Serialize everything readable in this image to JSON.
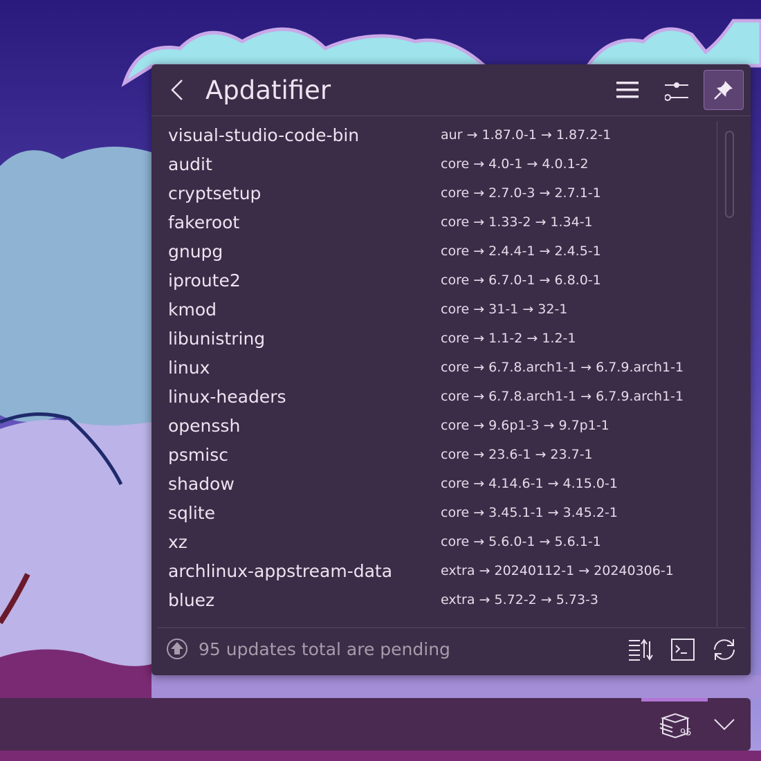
{
  "popup": {
    "title": "Apdatifier",
    "icons": {
      "back": "back-icon",
      "menu": "hamburger-icon",
      "settings": "sliders-icon",
      "pin": "pin-icon"
    }
  },
  "packages": [
    {
      "name": "visual-studio-code-bin",
      "version": "aur → 1.87.0-1 → 1.87.2-1"
    },
    {
      "name": "audit",
      "version": "core → 4.0-1 → 4.0.1-2"
    },
    {
      "name": "cryptsetup",
      "version": "core → 2.7.0-3 → 2.7.1-1"
    },
    {
      "name": "fakeroot",
      "version": "core → 1.33-2 → 1.34-1"
    },
    {
      "name": "gnupg",
      "version": "core → 2.4.4-1 → 2.4.5-1"
    },
    {
      "name": "iproute2",
      "version": "core → 6.7.0-1 → 6.8.0-1"
    },
    {
      "name": "kmod",
      "version": "core → 31-1 → 32-1"
    },
    {
      "name": "libunistring",
      "version": "core → 1.1-2 → 1.2-1"
    },
    {
      "name": "linux",
      "version": "core → 6.7.8.arch1-1 → 6.7.9.arch1-1"
    },
    {
      "name": "linux-headers",
      "version": "core → 6.7.8.arch1-1 → 6.7.9.arch1-1"
    },
    {
      "name": "openssh",
      "version": "core → 9.6p1-3 → 9.7p1-1"
    },
    {
      "name": "psmisc",
      "version": "core → 23.6-1 → 23.7-1"
    },
    {
      "name": "shadow",
      "version": "core → 4.14.6-1 → 4.15.0-1"
    },
    {
      "name": "sqlite",
      "version": "core → 3.45.1-1 → 3.45.2-1"
    },
    {
      "name": "xz",
      "version": "core → 5.6.0-1 → 5.6.1-1"
    },
    {
      "name": "archlinux-appstream-data",
      "version": "extra → 20240112-1 → 20240306-1"
    },
    {
      "name": "bluez",
      "version": "extra → 5.72-2 → 5.73-3"
    }
  ],
  "footer": {
    "status": "95 updates total are pending",
    "icons": {
      "status": "upload-circle-icon",
      "sort": "sort-icon",
      "terminal": "terminal-icon",
      "refresh": "refresh-icon"
    }
  },
  "panel": {
    "tray_badge": "95",
    "icons": {
      "tray": "package-box-icon",
      "expand": "chevron-down-icon"
    }
  },
  "colors": {
    "popup_bg": "#3b2c47",
    "pin_active": "#5d4372",
    "panel_bg": "#4a2a51",
    "panel_indicator": "#b175d6"
  }
}
